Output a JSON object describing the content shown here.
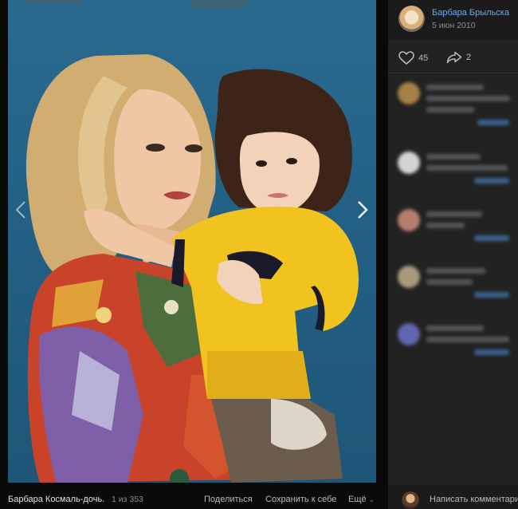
{
  "photo": {
    "alt": ""
  },
  "caption": {
    "title": "Барбара Космаль-дочь.",
    "counter": "1 из 353",
    "share_label": "Поделиться",
    "save_label": "Сохранить к себе",
    "more_label": "Ещё"
  },
  "author": {
    "name": "Барбара Брыльска",
    "date": "5 июн 2010"
  },
  "reactions": {
    "likes": "45",
    "shares": "2"
  },
  "comment_input": {
    "placeholder": "Написать комментарий"
  },
  "colors": {
    "link": "#71aaeb",
    "panel": "#222222",
    "backdrop": "#0a0a0a"
  }
}
